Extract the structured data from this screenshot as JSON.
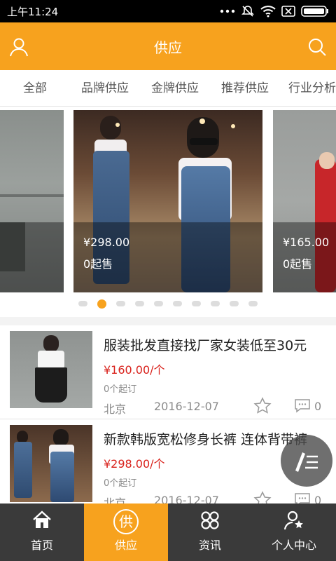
{
  "status_bar": {
    "time": "上午11:24"
  },
  "header": {
    "title": "供应",
    "left_icon": "user-icon",
    "right_icon": "search-icon",
    "color": "#f7a21e"
  },
  "tabs": [
    {
      "label": "全部"
    },
    {
      "label": "品牌供应"
    },
    {
      "label": "金牌供应"
    },
    {
      "label": "推荐供应"
    },
    {
      "label": "行业分析"
    }
  ],
  "carousel": {
    "slides": [
      {
        "price": "",
        "min_order": ""
      },
      {
        "price": "¥298.00",
        "min_order": "0起售"
      },
      {
        "price": "¥165.00",
        "min_order": "0起售"
      }
    ],
    "dot_count": 10,
    "active_dot": 1
  },
  "products": [
    {
      "title": "服装批发直接找厂家女装低至30元",
      "price": "¥160.00/个",
      "min_order": "0个起订",
      "location": "北京",
      "date": "2016-12-07",
      "comment_count": "0"
    },
    {
      "title": "新款韩版宽松修身长裤 连体背带裤",
      "price": "¥298.00/个",
      "min_order": "0个起订",
      "location": "北京",
      "date": "2016-12-07",
      "comment_count": "0"
    }
  ],
  "bottom_nav": [
    {
      "label": "首页",
      "icon": "home-icon"
    },
    {
      "label": "供应",
      "icon": "supply-icon",
      "icon_char": "供"
    },
    {
      "label": "资讯",
      "icon": "news-icon"
    },
    {
      "label": "个人中心",
      "icon": "profile-icon"
    }
  ],
  "colors": {
    "accent": "#f7a21e",
    "price": "#d9221c",
    "nav_bg": "#3a3a3a"
  }
}
